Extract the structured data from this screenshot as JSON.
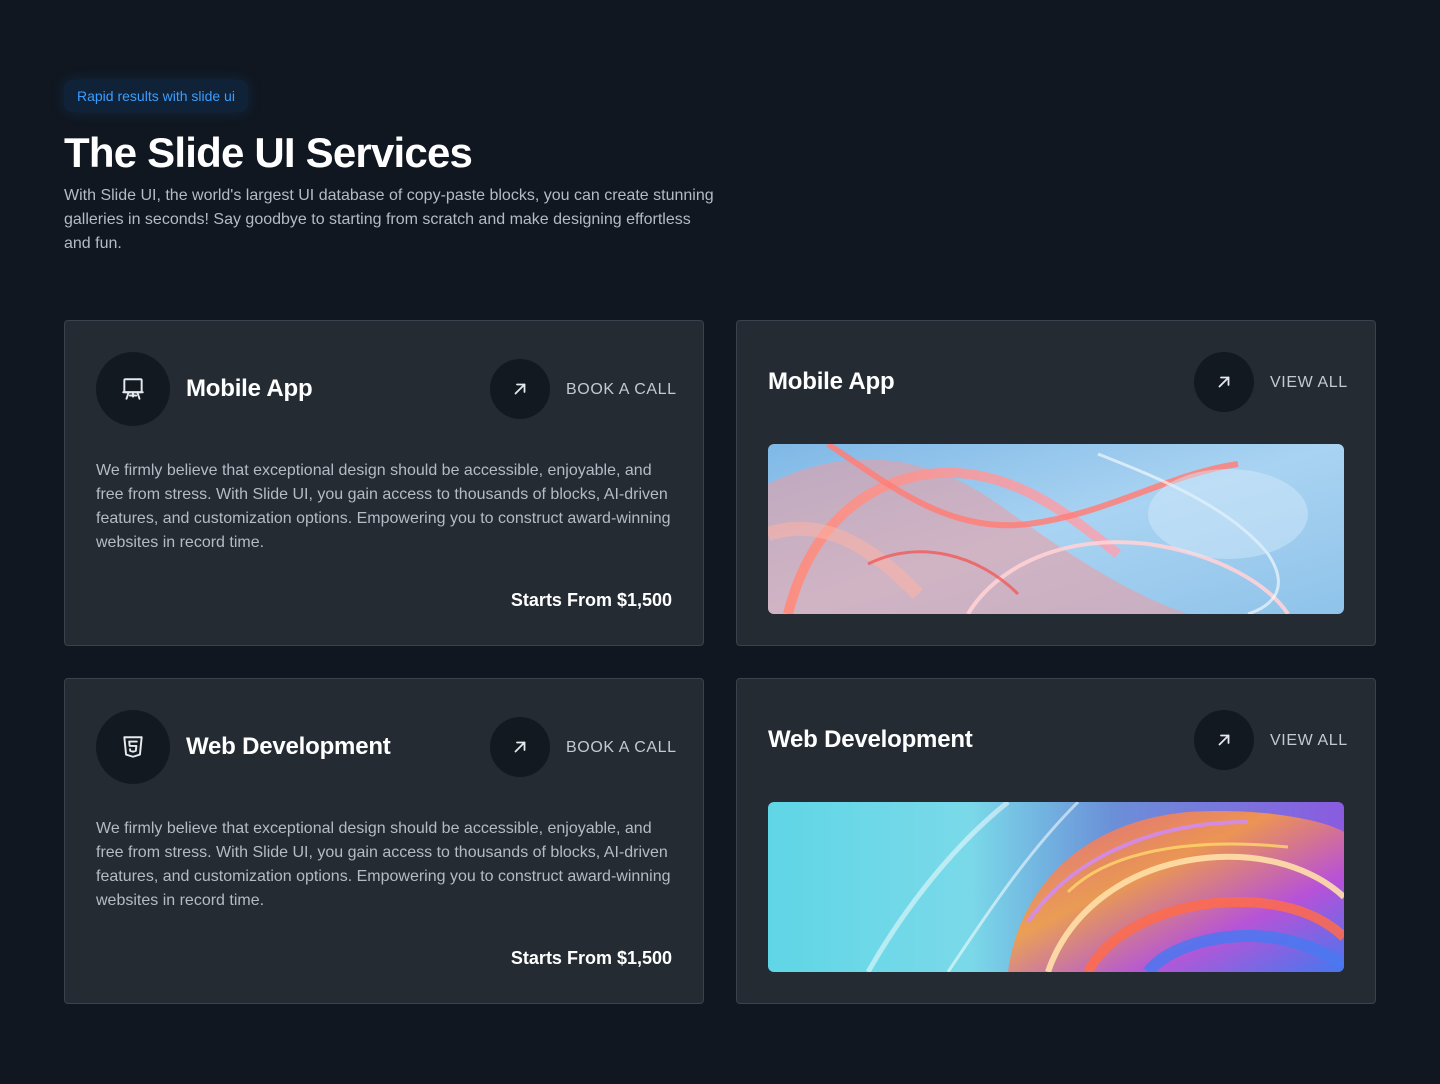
{
  "header": {
    "badge": "Rapid results with slide ui",
    "title": "The Slide UI Services",
    "subtitle": "With Slide UI, the world's largest UI database of copy-paste blocks, you can create stunning galleries in seconds! Say goodbye to starting from scratch and make designing effortless and fun."
  },
  "services": [
    {
      "icon": "easel-icon",
      "title": "Mobile App",
      "action": "BOOK A CALL",
      "description": "We firmly believe that exceptional design should be accessible, enjoyable, and free from stress. With Slide UI, you gain access to thousands of blocks, AI-driven features, and customization options. Empowering you to construct award-winning websites in record time.",
      "price": "Starts From $1,500"
    },
    {
      "icon": "html5-icon",
      "title": "Web Development",
      "action": "BOOK A CALL",
      "description": "We firmly believe that exceptional design should be accessible, enjoyable, and free from stress. With Slide UI, you gain access to thousands of blocks, AI-driven features, and customization options. Empowering you to construct award-winning websites in record time.",
      "price": "Starts From $1,500"
    }
  ],
  "galleries": [
    {
      "title": "Mobile App",
      "action": "VIEW ALL",
      "image": "abstract-glass-swirl-pink-blue"
    },
    {
      "title": "Web Development",
      "action": "VIEW ALL",
      "image": "abstract-glass-swirl-rainbow"
    }
  ],
  "colors": {
    "background": "#101720",
    "card": "#242b33",
    "card_border": "#3a434d",
    "badge_text": "#3b9dfd",
    "circle": "#121921"
  }
}
